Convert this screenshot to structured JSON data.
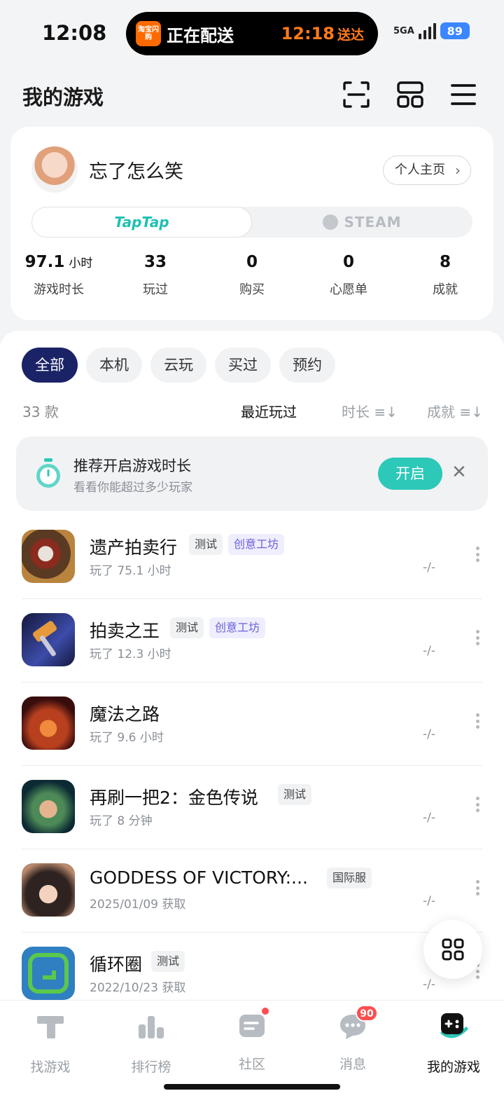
{
  "status_bar": {
    "time": "12:08",
    "island": {
      "app_logo": "淘宝闪购",
      "title": "正在配送",
      "eta": "12:18",
      "eta_suffix": "送达"
    },
    "network": "5GA",
    "battery": "89"
  },
  "header": {
    "title": "我的游戏",
    "icons": [
      "scan-icon",
      "layout-icon",
      "menu-icon"
    ]
  },
  "profile": {
    "username": "忘了怎么笑",
    "profile_link": "个人主页",
    "platforms": [
      {
        "label": "TapTap",
        "active": true
      },
      {
        "label": "STEAM",
        "active": false
      }
    ],
    "stats": [
      {
        "value": "97.1",
        "unit": "小时",
        "label": "游戏时长"
      },
      {
        "value": "33",
        "unit": "",
        "label": "玩过"
      },
      {
        "value": "0",
        "unit": "",
        "label": "购买"
      },
      {
        "value": "0",
        "unit": "",
        "label": "心愿单"
      },
      {
        "value": "8",
        "unit": "",
        "label": "成就"
      }
    ]
  },
  "filters": [
    {
      "label": "全部",
      "active": true
    },
    {
      "label": "本机",
      "active": false
    },
    {
      "label": "云玩",
      "active": false
    },
    {
      "label": "买过",
      "active": false
    },
    {
      "label": "预约",
      "active": false
    }
  ],
  "list_header": {
    "count": "33 款",
    "sort_recent": "最近玩过",
    "sort_duration": "时长",
    "sort_achievement": "成就"
  },
  "tip": {
    "title": "推荐开启游戏时长",
    "subtitle": "看看你能超过多少玩家",
    "button": "开启"
  },
  "games": [
    {
      "name": "遗产拍卖行",
      "tags": [
        "测试",
        "创意工坊"
      ],
      "meta": "玩了 75.1 小时",
      "score": "-/-",
      "icon": "auction-magnifier-icon",
      "color1": "#5a3a22",
      "color2": "#b9843e"
    },
    {
      "name": "拍卖之王",
      "tags": [
        "测试",
        "创意工坊"
      ],
      "meta": "玩了 12.3 小时",
      "score": "-/-",
      "icon": "gavel-icon",
      "color1": "#15183d",
      "color2": "#3c4ca8"
    },
    {
      "name": "魔法之路",
      "tags": [],
      "meta": "玩了 9.6 小时",
      "score": "-/-",
      "icon": "magic-road-icon",
      "color1": "#3a0d0d",
      "color2": "#d2562c"
    },
    {
      "name": "再刷一把2：金色传说",
      "tags": [
        "测试"
      ],
      "meta": "玩了 8 分钟",
      "score": "-/-",
      "icon": "hero-portrait-icon",
      "color1": "#0c2a33",
      "color2": "#4d8a58"
    },
    {
      "name": "GODDESS OF VICTORY:...",
      "tags": [
        "国际服"
      ],
      "meta": "2025/01/09 获取",
      "score": "-/-",
      "icon": "goddess-portrait-icon",
      "color1": "#2e2320",
      "color2": "#b8896d"
    },
    {
      "name": "循环圈",
      "tags": [
        "测试"
      ],
      "meta": "2022/10/23 获取",
      "score": "-/-",
      "icon": "loop-circle-icon",
      "color1": "#2f7fc1",
      "color2": "#5ac84c"
    }
  ],
  "bottom_nav": [
    {
      "label": "找游戏",
      "icon": "taptap-logo-icon",
      "active": false,
      "badge": ""
    },
    {
      "label": "排行榜",
      "icon": "ranking-icon",
      "active": false,
      "badge": ""
    },
    {
      "label": "社区",
      "icon": "community-icon",
      "active": false,
      "badge": "dot"
    },
    {
      "label": "消息",
      "icon": "message-icon",
      "active": false,
      "badge": "90"
    },
    {
      "label": "我的游戏",
      "icon": "gamepad-icon",
      "active": true,
      "badge": ""
    }
  ],
  "colors": {
    "accent": "#2cc8b8",
    "chip_active": "#1b2367",
    "tag_purple": "#6d62d8",
    "badge_red": "#ff4d4f"
  }
}
